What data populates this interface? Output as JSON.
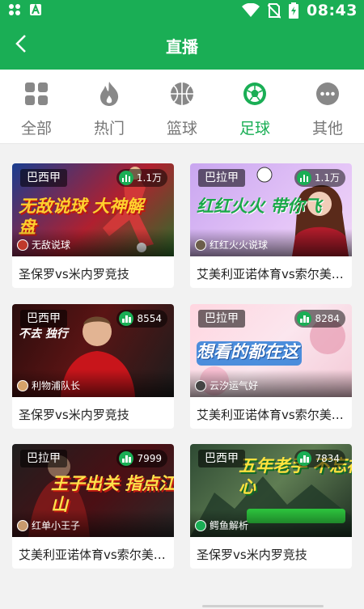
{
  "status_bar": {
    "time": "08:43",
    "icons": [
      "grid-icon",
      "a-icon",
      "wifi-icon",
      "no-sim-icon",
      "battery-charging-icon"
    ]
  },
  "header": {
    "title": "直播",
    "back_icon": "back-arrow-icon"
  },
  "tabs": [
    {
      "label": "全部",
      "icon": "grid-four-icon",
      "active": false
    },
    {
      "label": "热门",
      "icon": "flame-icon",
      "active": false
    },
    {
      "label": "篮球",
      "icon": "basketball-icon",
      "active": false
    },
    {
      "label": "足球",
      "icon": "soccer-ball-icon",
      "active": true
    },
    {
      "label": "其他",
      "icon": "more-dots-icon",
      "active": false
    }
  ],
  "cards": [
    {
      "league": "巴西甲",
      "views": "1.1万",
      "anchor": "无敌说球",
      "tagline": "无敌说球 大神解盘",
      "title": "圣保罗vs米内罗竞技"
    },
    {
      "league": "巴拉甲",
      "views": "1.1万",
      "anchor": "红红火火说球",
      "tagline": "红红火火 带你飞",
      "title": "艾美利亚诺体育vs索尔美…"
    },
    {
      "league": "巴西甲",
      "views": "8554",
      "anchor": "利物浦队长",
      "tagline": "不去 独行",
      "title": "圣保罗vs米内罗竞技"
    },
    {
      "league": "巴拉甲",
      "views": "8284",
      "anchor": "云汐运气好",
      "tagline": "想看的都在这",
      "title": "艾美利亚诺体育vs索尔美…"
    },
    {
      "league": "巴拉甲",
      "views": "7999",
      "anchor": "红单小王子",
      "tagline": "王子出关 指点江山",
      "title": "艾美利亚诺体育vs索尔美…"
    },
    {
      "league": "巴西甲",
      "views": "7834",
      "anchor": "鳄鱼解析",
      "tagline": "五年老手 不忘初心",
      "title": "圣保罗vs米内罗竞技"
    }
  ],
  "colors": {
    "brand": "#1aae55",
    "active_tab": "#1aae55",
    "inactive_tab": "#777777"
  }
}
